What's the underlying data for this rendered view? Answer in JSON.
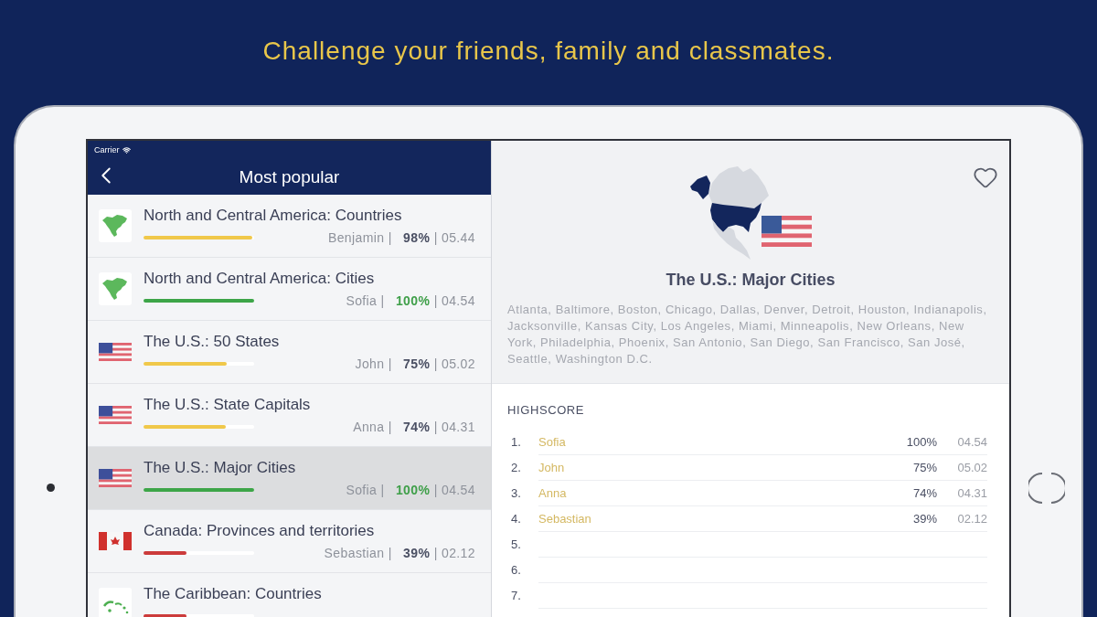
{
  "headline": "Challenge your friends, family and classmates.",
  "status_bar": {
    "carrier": "Carrier"
  },
  "list_panel": {
    "title": "Most popular",
    "rows": [
      {
        "kind": "continent",
        "title": "North and Central America: Countries",
        "level": 0.98,
        "color": "#f0c84a",
        "stats": "Benjamin | **98%** | 05.44",
        "selected": false
      },
      {
        "kind": "continent",
        "title": "North and Central America: Cities",
        "level": 1,
        "color": "#3da548",
        "stats": "Sofia | **100%** | 04.54",
        "selected": false
      },
      {
        "kind": "us_flag",
        "title": "The U.S.: 50 States",
        "level": 0.75,
        "color": "#f0c84a",
        "stats": "John | **75%** | 05.02",
        "selected": false
      },
      {
        "kind": "us_flag",
        "title": "The U.S.: State Capitals",
        "level": 0.74,
        "color": "#f0c84a",
        "stats": "Anna | **74%** | 04.31",
        "selected": false
      },
      {
        "kind": "us_flag",
        "title": "The U.S.: Major Cities",
        "level": 1,
        "color": "#3da548",
        "stats": "Sofia | **100%** | 04.54",
        "selected": true
      },
      {
        "kind": "canada_flag",
        "title": "Canada: Provinces and territories",
        "level": 0.39,
        "color": "#cc3b3b",
        "stats": "Sebastian | **39%** | 02.12",
        "selected": false
      },
      {
        "kind": "caribbean",
        "title": "The Caribbean: Countries",
        "level": 0.39,
        "color": "#cc3b3b",
        "selected": false
      }
    ]
  },
  "detail": {
    "favorite": false,
    "title": "The U.S.: Major Cities",
    "description": "Atlanta, Baltimore, Boston, Chicago, Dallas, Denver, Detroit, Houston, Indianapolis, Jacksonville, Kansas City, Los Angeles, Miami, Minneapolis, New Orleans, New York, Philadelphia, Phoenix, San Antonio, San Diego, San Francisco, San José, Seattle, Washington D.C.",
    "highscore": {
      "heading": "HIGHSCORE",
      "entries": [
        {
          "rank": "1.",
          "name": "Sofia",
          "score": "100%",
          "time": "04.54"
        },
        {
          "rank": "2.",
          "name": "John",
          "score": "75%",
          "time": "05.02"
        },
        {
          "rank": "3.",
          "name": "Anna",
          "score": "74%",
          "time": "04.31"
        },
        {
          "rank": "4.",
          "name": "Sebastian",
          "score": "39%",
          "time": "02.12"
        },
        {
          "rank": "5."
        },
        {
          "rank": "6."
        },
        {
          "rank": "7."
        }
      ]
    }
  }
}
